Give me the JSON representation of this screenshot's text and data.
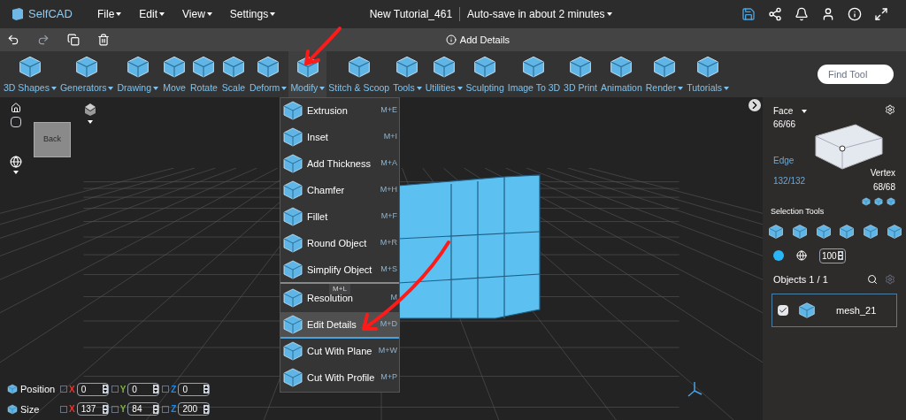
{
  "menubar": {
    "logo": "SelfCAD",
    "menus": [
      "File",
      "Edit",
      "View",
      "Settings"
    ],
    "title": "New Tutorial_461",
    "autosave": "Auto-save in about 2 minutes"
  },
  "action_bar": {
    "hint": "Add Details"
  },
  "toolbar": {
    "items": [
      {
        "label": "3D Shapes",
        "dropdown": true,
        "selected": false
      },
      {
        "label": "Generators",
        "dropdown": true,
        "selected": false
      },
      {
        "label": "Drawing",
        "dropdown": true,
        "selected": false
      },
      {
        "label": "Move",
        "dropdown": false,
        "selected": false
      },
      {
        "label": "Rotate",
        "dropdown": false,
        "selected": false
      },
      {
        "label": "Scale",
        "dropdown": false,
        "selected": false
      },
      {
        "label": "Deform",
        "dropdown": true,
        "selected": false
      },
      {
        "label": "Modify",
        "dropdown": true,
        "selected": true
      },
      {
        "label": "Stitch & Scoop",
        "dropdown": false,
        "selected": false
      },
      {
        "label": "Tools",
        "dropdown": true,
        "selected": false
      },
      {
        "label": "Utilities",
        "dropdown": true,
        "selected": false
      },
      {
        "label": "Sculpting",
        "dropdown": false,
        "selected": false
      },
      {
        "label": "Image To 3D",
        "dropdown": false,
        "selected": false
      },
      {
        "label": "3D Print",
        "dropdown": false,
        "selected": false
      },
      {
        "label": "Animation",
        "dropdown": false,
        "selected": false
      },
      {
        "label": "Render",
        "dropdown": true,
        "selected": false
      },
      {
        "label": "Tutorials",
        "dropdown": true,
        "selected": false
      }
    ],
    "search": {
      "placeholder": "Find Tool"
    }
  },
  "modify_menu": {
    "items": [
      {
        "label": "Extrusion",
        "shortcut": "M+E",
        "selected": false,
        "divider_after": false
      },
      {
        "label": "Inset",
        "shortcut": "M+I",
        "selected": false,
        "divider_after": false
      },
      {
        "label": "Add Thickness",
        "shortcut": "M+A",
        "selected": false,
        "divider_after": false
      },
      {
        "label": "Chamfer",
        "shortcut": "M+H",
        "selected": false,
        "divider_after": false
      },
      {
        "label": "Fillet",
        "shortcut": "M+F",
        "selected": false,
        "divider_after": false
      },
      {
        "label": "Round Object",
        "shortcut": "M+R",
        "selected": false,
        "divider_after": false
      },
      {
        "label": "Simplify Object",
        "shortcut": "M+S",
        "selected": false,
        "divider_after": true
      },
      {
        "label": "Resolution",
        "shortcut": "M",
        "selected": false,
        "divider_after": false
      },
      {
        "label": "Edit Details",
        "shortcut": "M+D",
        "selected": true,
        "divider_after": true
      },
      {
        "label": "Cut With Plane",
        "shortcut": "M+W",
        "selected": false,
        "divider_after": false
      },
      {
        "label": "Cut With Profile",
        "shortcut": "M+P",
        "selected": false,
        "divider_after": false
      }
    ],
    "tooltip": "M+L"
  },
  "view_cube": {
    "face": "Back"
  },
  "transform": {
    "rows": [
      {
        "label": "Position",
        "fields": [
          {
            "axis": "X",
            "color": "#e53935",
            "value": "0",
            "locked": false
          },
          {
            "axis": "Y",
            "color": "#7cb342",
            "value": "0",
            "locked": false
          },
          {
            "axis": "Z",
            "color": "#1e88e5",
            "value": "0",
            "locked": false
          }
        ]
      },
      {
        "label": "Size",
        "fields": [
          {
            "axis": "X",
            "color": "#e53935",
            "value": "137",
            "locked": false
          },
          {
            "axis": "Y",
            "color": "#7cb342",
            "value": "84",
            "locked": false
          },
          {
            "axis": "Z",
            "color": "#1e88e5",
            "value": "200",
            "locked": false
          }
        ]
      }
    ]
  },
  "selection_panel": {
    "face_label": "Face",
    "face_count": "66/66",
    "edge_label": "Edge",
    "edge_count": "132/132",
    "vertex_label": "Vertex",
    "vertex_count": "68/68",
    "tools_label": "Selection Tools",
    "opacity": "100"
  },
  "objects": {
    "title": "Objects 1 / 1",
    "items": [
      {
        "name": "mesh_21",
        "checked": true
      }
    ]
  }
}
